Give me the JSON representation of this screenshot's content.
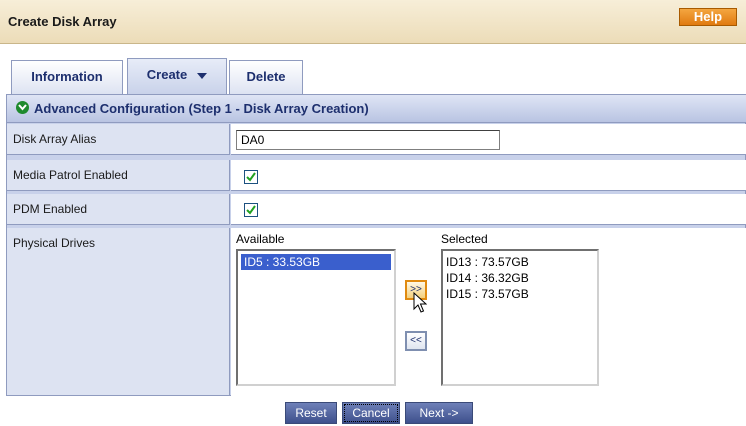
{
  "header": {
    "title": "Create Disk Array",
    "help_label": "Help"
  },
  "tabs": [
    {
      "label": "Information"
    },
    {
      "label": "Create",
      "active": true
    },
    {
      "label": "Delete"
    }
  ],
  "section": {
    "title": "Advanced Configuration (Step 1 - Disk Array Creation)",
    "icon": "chevron-down-circle-icon"
  },
  "form": {
    "alias_label": "Disk Array Alias",
    "alias_value": "DA0",
    "media_patrol_label": "Media Patrol Enabled",
    "media_patrol_checked": true,
    "pdm_label": "PDM Enabled",
    "pdm_checked": true,
    "drives_label": "Physical Drives"
  },
  "drives": {
    "available_caption": "Available",
    "selected_caption": "Selected",
    "available": [
      "ID5 : 33.53GB"
    ],
    "selected": [
      "ID13 : 73.57GB",
      "ID14 : 36.32GB",
      "ID15 : 73.57GB"
    ],
    "add_label": ">>",
    "remove_label": "<<"
  },
  "buttons": {
    "reset": "Reset",
    "cancel": "Cancel",
    "next": "Next ->"
  },
  "colors": {
    "accent": "#e07a10",
    "header_text": "#1d2f6e",
    "panel": "#c8d1ea",
    "selection": "#3a5fcd"
  }
}
